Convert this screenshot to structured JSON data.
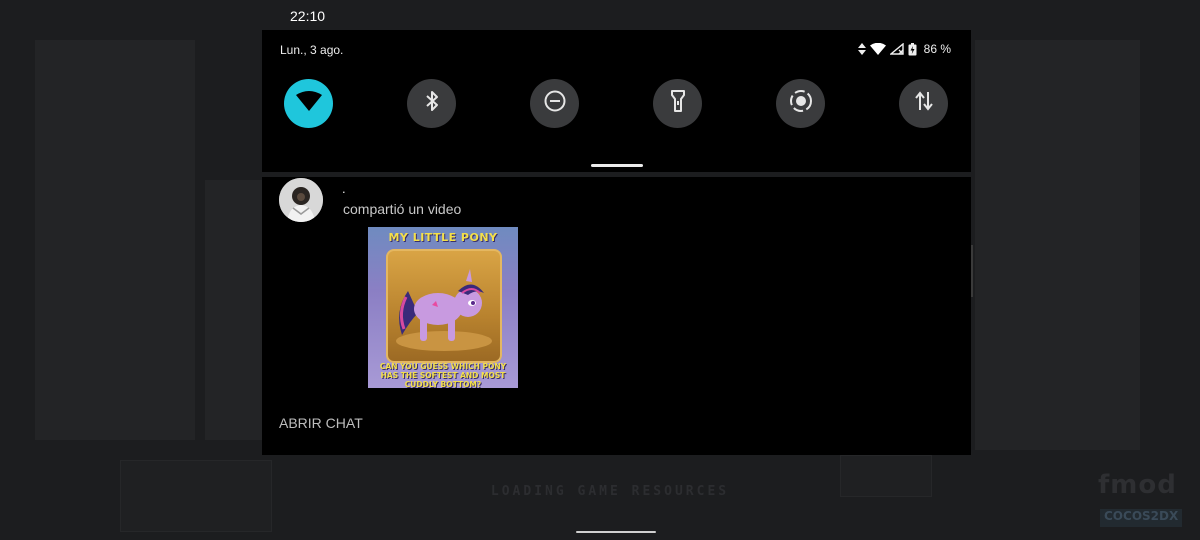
{
  "status_bar": {
    "time": "22:10"
  },
  "quick_settings": {
    "date": "Lun., 3 ago.",
    "battery_percent": "86 %",
    "tiles": [
      {
        "name": "wifi",
        "icon": "wifi-icon",
        "active": true
      },
      {
        "name": "bluetooth",
        "icon": "bluetooth-icon",
        "active": false
      },
      {
        "name": "do-not-disturb",
        "icon": "do-not-disturb-icon",
        "active": false
      },
      {
        "name": "flashlight",
        "icon": "flashlight-icon",
        "active": false
      },
      {
        "name": "screen-record",
        "icon": "screen-record-icon",
        "active": false
      },
      {
        "name": "mobile-data",
        "icon": "data-transfer-icon",
        "active": false
      }
    ],
    "active_color": "#1fc6dc"
  },
  "notification": {
    "title": ".",
    "text": "compartió un video",
    "media": {
      "top_caption": "MY LITTLE PONY",
      "bottom_caption": "CAN YOU GUESS WHICH PONY HAS THE SOFTEST AND MOST CUDDLY BOTTOM?"
    },
    "action_label": "ABRIR CHAT"
  },
  "background": {
    "loading_text": "LOADING GAME RESOURCES",
    "brand_1": "fmod",
    "brand_2": "COCOS2DX"
  }
}
